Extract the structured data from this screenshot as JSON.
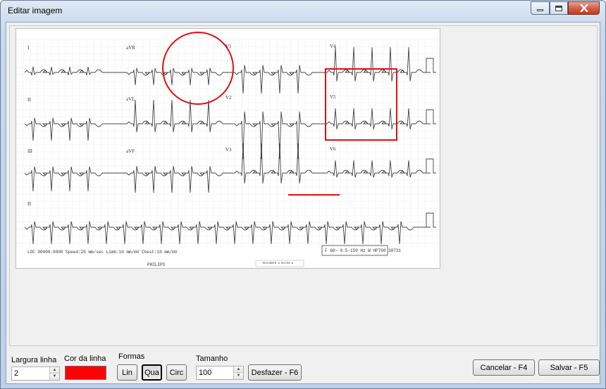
{
  "window": {
    "title": "Editar imagem"
  },
  "ecg": {
    "leads": {
      "r1": [
        "I",
        "aVR",
        "V1",
        "V4"
      ],
      "r2": [
        "II",
        "aVL",
        "V2",
        "V5"
      ],
      "r3": [
        "III",
        "aVF",
        "V3",
        "V6"
      ],
      "r4": [
        "II"
      ]
    },
    "footer_left": "LOC 00000-0000   Speed:25 mm/sec   Limb:10 mm/mV   Chest:10 mm/mV",
    "footer_right": "F 60~ 0.5-150 Hz W   HP708   38731",
    "brand": "PHILIPS",
    "stamp": "RECORDER # M1700 A"
  },
  "controls": {
    "line_width_label": "Largura linha",
    "line_width_value": "2",
    "line_color_label": "Cor da linha",
    "line_color": "#ff0000",
    "shapes_label": "Formas",
    "shape_line": "Lin",
    "shape_square": "Qua",
    "shape_circle": "Circ",
    "size_label": "Tamanho",
    "size_value": "100",
    "undo": "Desfazer - F6",
    "cancel": "Cancelar - F4",
    "save": "Salvar - F5"
  },
  "annotations": {
    "color": "#e01010"
  }
}
